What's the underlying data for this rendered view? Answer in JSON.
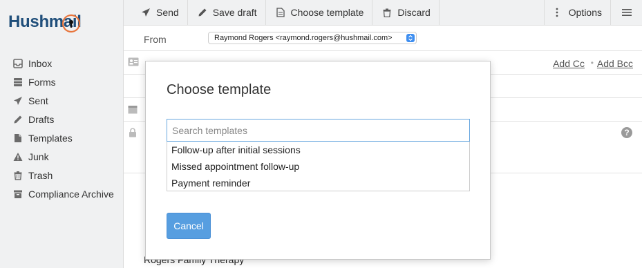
{
  "brand": {
    "logo_text": "Hushmail"
  },
  "sidebar": {
    "items": [
      {
        "label": "Inbox",
        "icon": "inbox-icon"
      },
      {
        "label": "Forms",
        "icon": "forms-icon"
      },
      {
        "label": "Sent",
        "icon": "send-icon"
      },
      {
        "label": "Drafts",
        "icon": "pencil-icon"
      },
      {
        "label": "Templates",
        "icon": "templates-icon"
      },
      {
        "label": "Junk",
        "icon": "warning-icon"
      },
      {
        "label": "Trash",
        "icon": "trash-icon"
      },
      {
        "label": "Compliance Archive",
        "icon": "archive-icon"
      }
    ]
  },
  "toolbar": {
    "send": "Send",
    "save_draft": "Save draft",
    "choose_template": "Choose template",
    "discard": "Discard",
    "options": "Options"
  },
  "compose": {
    "from_label": "From",
    "from_value": "Raymond Rogers <raymond.rogers@hushmail.com>",
    "add_cc": "Add Cc",
    "dot": "•",
    "add_bcc": "Add Bcc",
    "help": "?",
    "signature": "Rogers Family Therapy"
  },
  "modal": {
    "title": "Choose template",
    "search_placeholder": "Search templates",
    "templates": [
      "Follow-up after initial sessions",
      "Missed appointment follow-up",
      "Payment reminder"
    ],
    "cancel_label": "Cancel"
  },
  "colors": {
    "brand_blue": "#1f4e7a",
    "brand_orange": "#e8743b",
    "button_blue": "#579ee0",
    "focus_border": "#66a6df"
  }
}
